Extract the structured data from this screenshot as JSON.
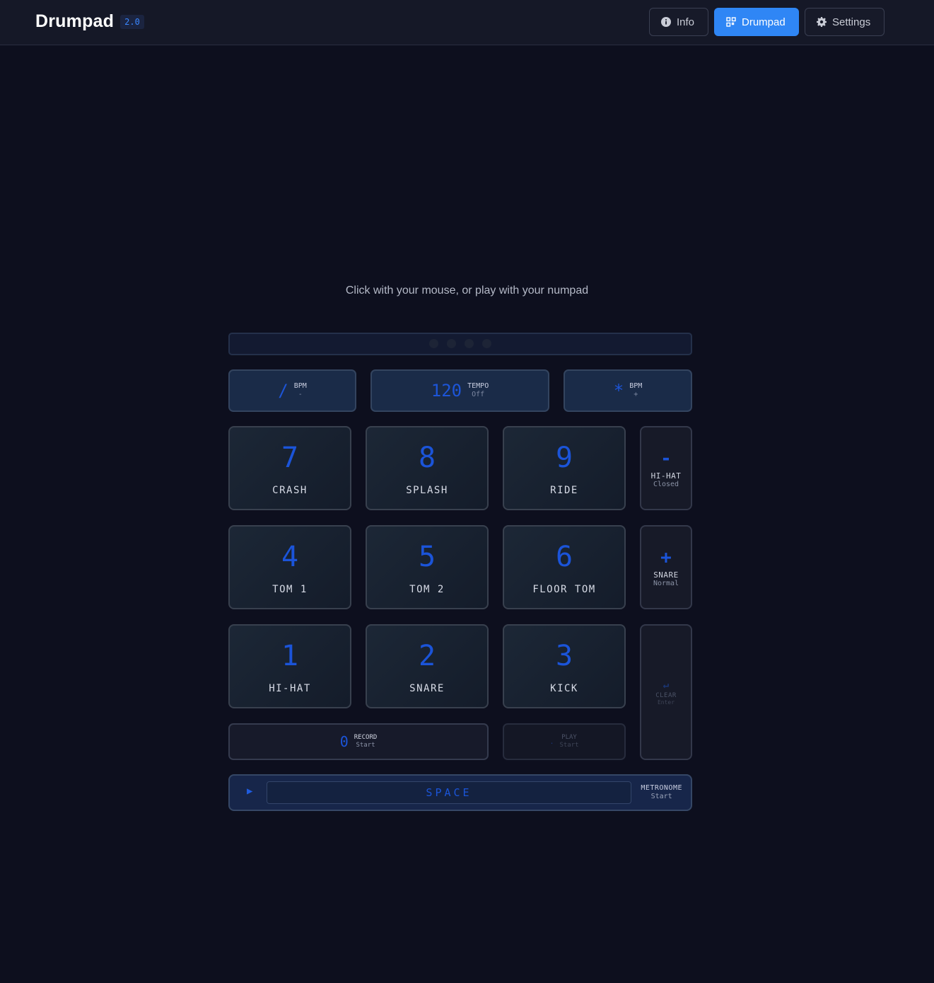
{
  "app": {
    "title": "Drumpad",
    "version": "2.0"
  },
  "nav": [
    {
      "label": "Info",
      "icon": "info-icon",
      "active": false
    },
    {
      "label": "Drumpad",
      "icon": "grid-icon",
      "active": true
    },
    {
      "label": "Settings",
      "icon": "gear-icon",
      "active": false
    }
  ],
  "subtitle": "Click with your mouse, or play with your numpad",
  "controls": {
    "bpm_down": {
      "key": "/",
      "label": "BPM",
      "sub": "-"
    },
    "tempo": {
      "value": "120",
      "label": "TEMPO",
      "sub": "Off"
    },
    "bpm_up": {
      "key": "*",
      "label": "BPM",
      "sub": "+"
    }
  },
  "pads": [
    {
      "key": "7",
      "name": "CRASH"
    },
    {
      "key": "8",
      "name": "SPLASH"
    },
    {
      "key": "9",
      "name": "RIDE"
    },
    {
      "key": "4",
      "name": "TOM 1"
    },
    {
      "key": "5",
      "name": "TOM 2"
    },
    {
      "key": "6",
      "name": "FLOOR TOM"
    },
    {
      "key": "1",
      "name": "HI-HAT"
    },
    {
      "key": "2",
      "name": "SNARE"
    },
    {
      "key": "3",
      "name": "KICK"
    }
  ],
  "side": {
    "minus": {
      "key": "-",
      "label": "HI-HAT",
      "sub": "Closed"
    },
    "plus": {
      "key": "+",
      "label": "SNARE",
      "sub": "Normal"
    },
    "enter": {
      "key": "↵",
      "label": "CLEAR",
      "sub": "Enter"
    }
  },
  "record": {
    "key": "0",
    "label": "RECORD",
    "sub": "Start"
  },
  "play": {
    "key": ".",
    "label": "PLAY",
    "sub": "Start"
  },
  "spacebar": {
    "key": "SPACE",
    "label": "METRONOME",
    "sub": "Start"
  },
  "colors": {
    "accent": "#2f86f5",
    "key_blue": "#1b54d9",
    "background": "#0d0f1e"
  }
}
